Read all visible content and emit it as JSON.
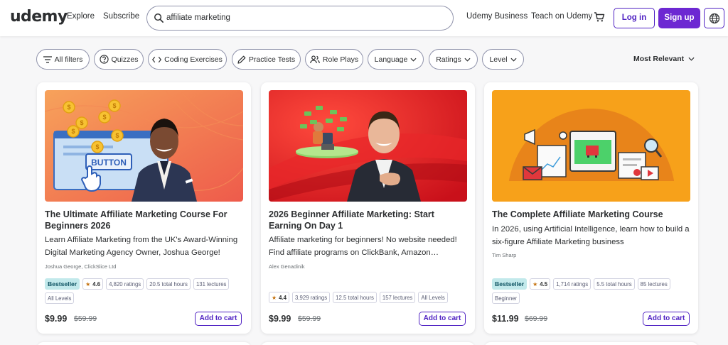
{
  "header": {
    "logo": "udemy",
    "explore": "Explore",
    "subscribe": "Subscribe",
    "search_value": "affiliate marketing",
    "business": "Udemy Business",
    "teach": "Teach on Udemy",
    "login": "Log in",
    "signup": "Sign up"
  },
  "filters": {
    "chips": [
      "All filters",
      "Quizzes",
      "Coding Exercises",
      "Practice Tests",
      "Role Plays",
      "Language",
      "Ratings",
      "Level"
    ],
    "sort": "Most Relevant"
  },
  "courses": [
    {
      "title": "The Ultimate Affiliate Marketing Course For Beginners 2026",
      "description": "Learn Affiliate Marketing from the UK's Award-Winning Digital Marketing Agency Owner, Joshua George!",
      "instructor": "Joshua George, ClickSlice Ltd",
      "bestseller": "Bestseller",
      "rating": "4.6",
      "ratings_count": "4,820 ratings",
      "hours": "20.5 total hours",
      "lectures": "131 lectures",
      "level": "All Levels",
      "price": "$9.99",
      "old_price": "$59.99",
      "add_to_cart": "Add to cart",
      "thumb_text": "BUTTON"
    },
    {
      "title": "2026 Beginner Affiliate Marketing: Start Earning On Day 1",
      "description": "Affiliate marketing for beginners! No website needed! Find affiliate programs on ClickBank, Amazon…",
      "instructor": "Alex Genadinik",
      "rating": "4.4",
      "ratings_count": "3,929 ratings",
      "hours": "12.5 total hours",
      "lectures": "157 lectures",
      "level": "All Levels",
      "price": "$9.99",
      "old_price": "$59.99",
      "add_to_cart": "Add to cart"
    },
    {
      "title": "The Complete Affiliate Marketing Course",
      "description": "In 2026, using Artificial Intelligence, learn how to build a six-figure Affiliate Marketing business",
      "instructor": "Tim Sharp",
      "bestseller": "Bestseller",
      "rating": "4.5",
      "ratings_count": "1,714 ratings",
      "hours": "5.5 total hours",
      "lectures": "85 lectures",
      "level": "Beginner",
      "price": "$11.99",
      "old_price": "$69.99",
      "add_to_cart": "Add to cart"
    }
  ],
  "colors": {
    "brand_purple": "#6d28d2",
    "link_purple": "#5022c3",
    "bestseller_bg": "#c2e9eb",
    "star": "#c4710d"
  },
  "icons": {
    "search": "search-icon",
    "cart": "cart-icon",
    "globe": "globe-icon",
    "filter": "filter-icon",
    "quizzes": "question-circle-icon",
    "coding": "code-icon",
    "practice": "pencil-icon",
    "roleplay": "people-icon",
    "chevron": "chevron-down-icon"
  }
}
